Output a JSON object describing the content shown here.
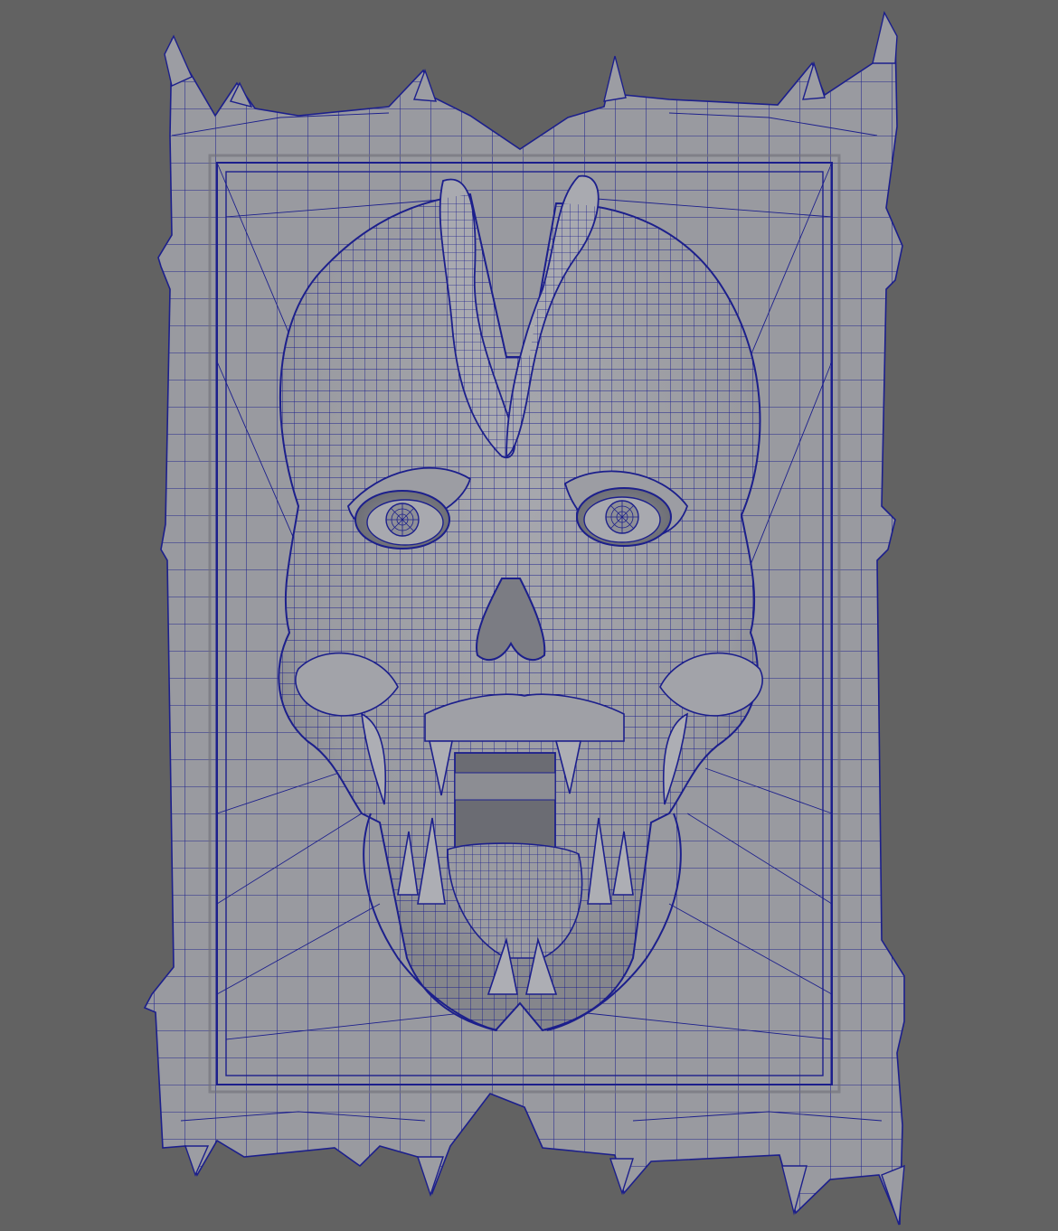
{
  "scene": {
    "subject": "skull-relief-panel-wireframe",
    "shading": "grey-smooth-with-wireframe-overlay"
  },
  "colors": {
    "background": "#626262",
    "mesh_fill": "#999aa0",
    "mesh_fill_light": "#a5a6ac",
    "mesh_shadow": "#6f7078",
    "wireframe": "#1c1f8c",
    "cavity": "#55565c"
  }
}
